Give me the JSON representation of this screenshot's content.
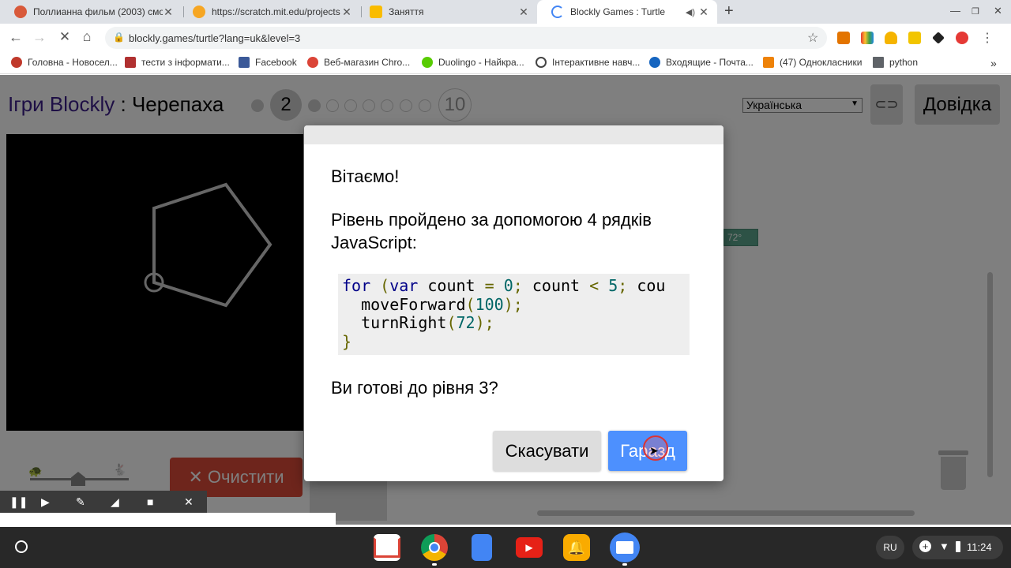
{
  "browser": {
    "tabs": [
      {
        "title": "Поллианна фильм (2003) смот",
        "icon_color": "#d8593a"
      },
      {
        "title": "https://scratch.mit.edu/projects",
        "icon_color": "#f6a623"
      },
      {
        "title": "Заняття",
        "icon_color": "#f9bc00"
      },
      {
        "title": "Blockly Games : Turtle",
        "icon_color": "#4285f4"
      }
    ],
    "new_tab": "+",
    "url": "blockly.games/turtle?lang=uk&level=3",
    "bookmarks": [
      "Головна - Новосел...",
      "тести з інформати...",
      "Facebook",
      "Веб-магазин Chro...",
      "Duolingo - Найкра...",
      "Інтерактивне навч...",
      "Входящие - Почта...",
      "(47) Однокласники",
      "python"
    ],
    "more_bookmarks": "»"
  },
  "game": {
    "title_link": "Ігри Blockly",
    "title_sep": " : ",
    "title_name": "Черепаха",
    "level_current": "2",
    "level_last": "10",
    "language": "Українська",
    "help_button": "Довідка",
    "clear_button": "Очистити",
    "block_value": "72°",
    "clear_icon": "✕"
  },
  "dialog": {
    "heading": "Вітаємо!",
    "message_line1": "Рівень пройдено за допомогою 4 рядків",
    "message_line2": "JavaScript:",
    "code": {
      "l1_kw1": "for",
      "l1_p1": " (",
      "l1_kw2": "var",
      "l1_t1": " count ",
      "l1_p2": "=",
      "l1_n1": " 0",
      "l1_p3": ";",
      "l1_t2": " count ",
      "l1_p4": "<",
      "l1_n2": " 5",
      "l1_p5": ";",
      "l1_t3": " cou",
      "l2_t": "  moveForward",
      "l2_p1": "(",
      "l2_n": "100",
      "l2_p2": ");",
      "l3_t": "  turnRight",
      "l3_p1": "(",
      "l3_n": "72",
      "l3_p2": ");",
      "l4_p": "}"
    },
    "question": "Ви готові до рівня 3?",
    "cancel_button": "Скасувати",
    "ok_button": "Гаразд"
  },
  "status": {
    "input_lang": "RU",
    "time": "11:24"
  },
  "colors": {
    "ok_button": "#4d90fe",
    "clear_button": "#dd4b39",
    "title_link": "#3c1f8a"
  }
}
